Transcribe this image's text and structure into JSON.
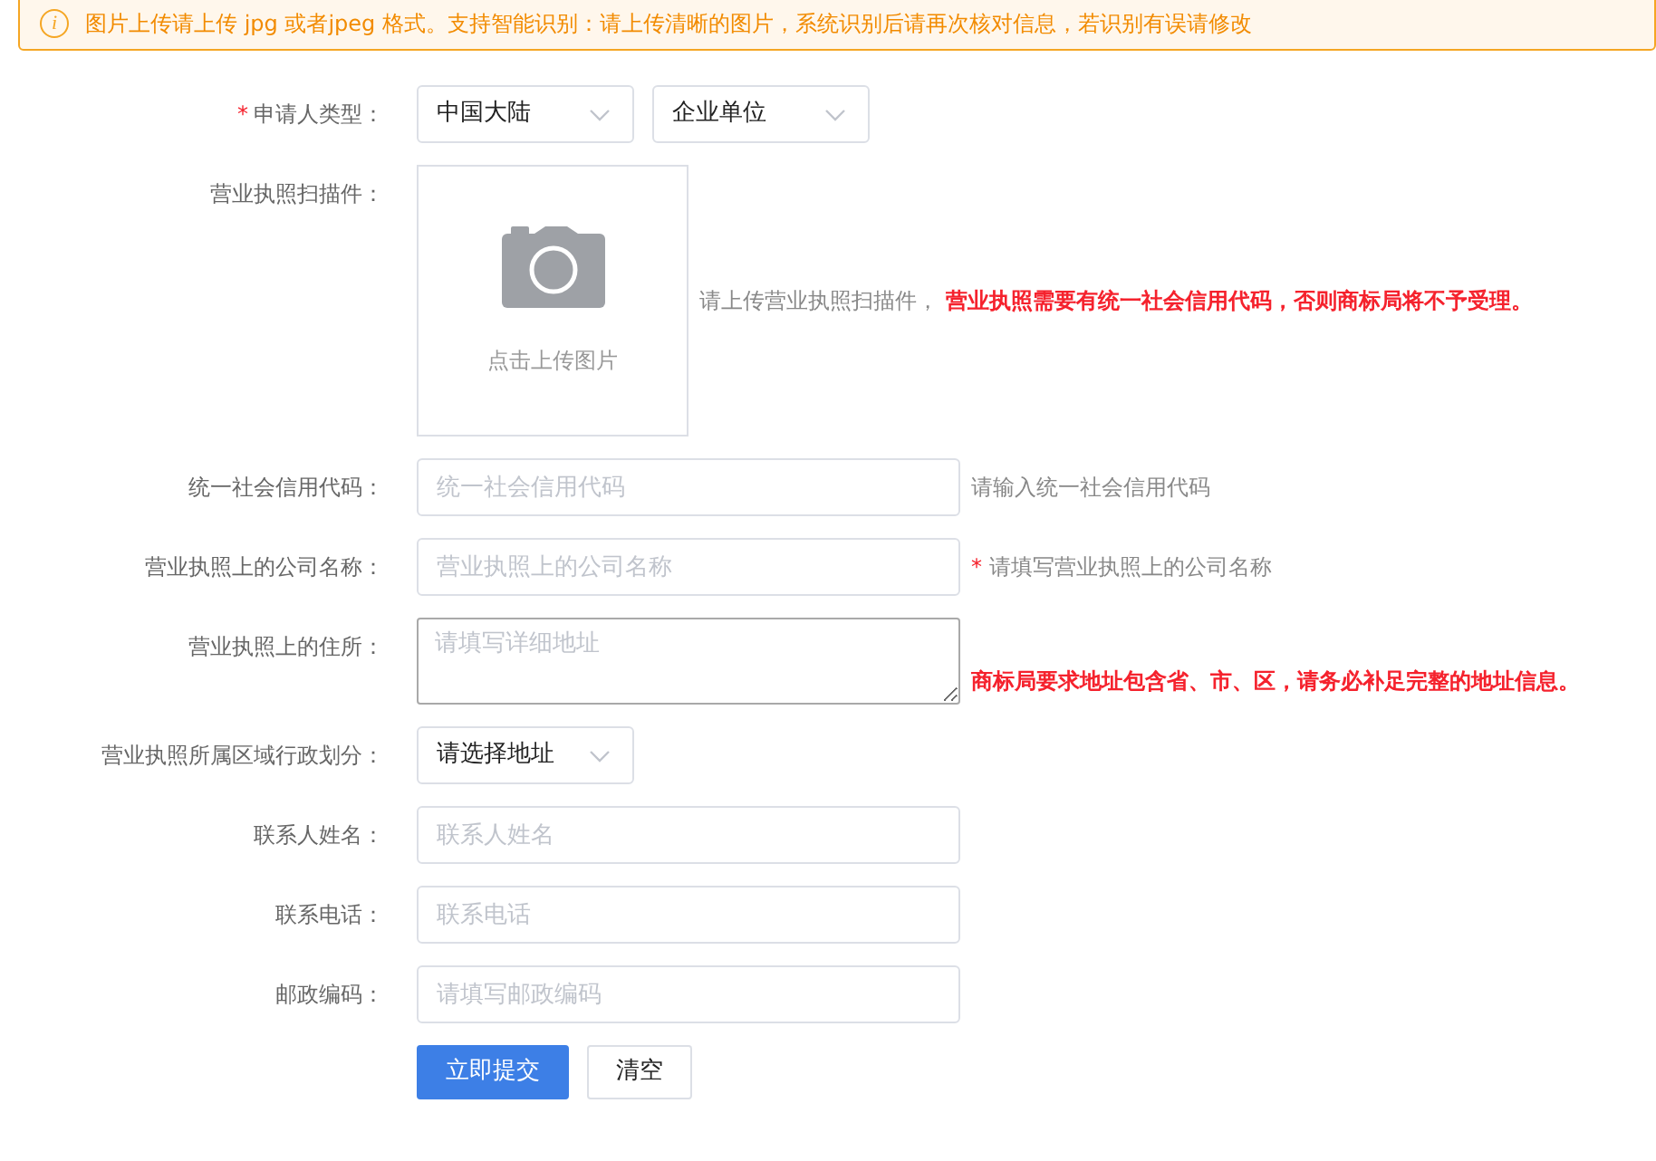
{
  "notice": {
    "icon": "i",
    "text": "图片上传请上传 jpg 或者jpeg 格式。支持智能识别：请上传清晰的图片，系统识别后请再次核对信息，若识别有误请修改"
  },
  "fields": [
    {
      "kind": "select_pair",
      "label": "申请人类型：",
      "mark": "*",
      "values": [
        "中国大陆",
        "企业单位"
      ]
    },
    {
      "kind": "upload",
      "label": "营业执照扫描件：",
      "upload_text": "点击上传图片",
      "hint": {
        "text": "请上传营业执照扫描件， **营业执照需要有统一社会信用代码，否则商标局将不予受理。**"
      }
    },
    {
      "kind": "input",
      "label": "统一社会信用代码：",
      "placeholder": "统一社会信用代码",
      "hint": {
        "text": "请输入统一社会信用代码"
      }
    },
    {
      "kind": "input",
      "label": "营业执照上的公司名称：",
      "placeholder": "营业执照上的公司名称",
      "hint": {
        "mark": "*",
        "text": "请填写营业执照上的公司名称"
      }
    },
    {
      "kind": "textarea",
      "label": "营业执照上的住所：",
      "placeholder": "请填写详细地址",
      "hint": {
        "text": "**商标局要求地址包含省、市、区，请务必补足完整的地址信息。**"
      }
    },
    {
      "kind": "select",
      "label": "营业执照所属区域行政划分：",
      "values": [
        "请选择地址"
      ]
    },
    {
      "kind": "input",
      "label": "联系人姓名：",
      "placeholder": "联系人姓名"
    },
    {
      "kind": "input",
      "label": "联系电话：",
      "placeholder": "联系电话"
    },
    {
      "kind": "input",
      "label": "邮政编码：",
      "placeholder": "请填写邮政编码"
    }
  ],
  "buttons": [
    {
      "label": "立即提交",
      "kind": "primary"
    },
    {
      "label": "清空",
      "kind": "default"
    }
  ]
}
